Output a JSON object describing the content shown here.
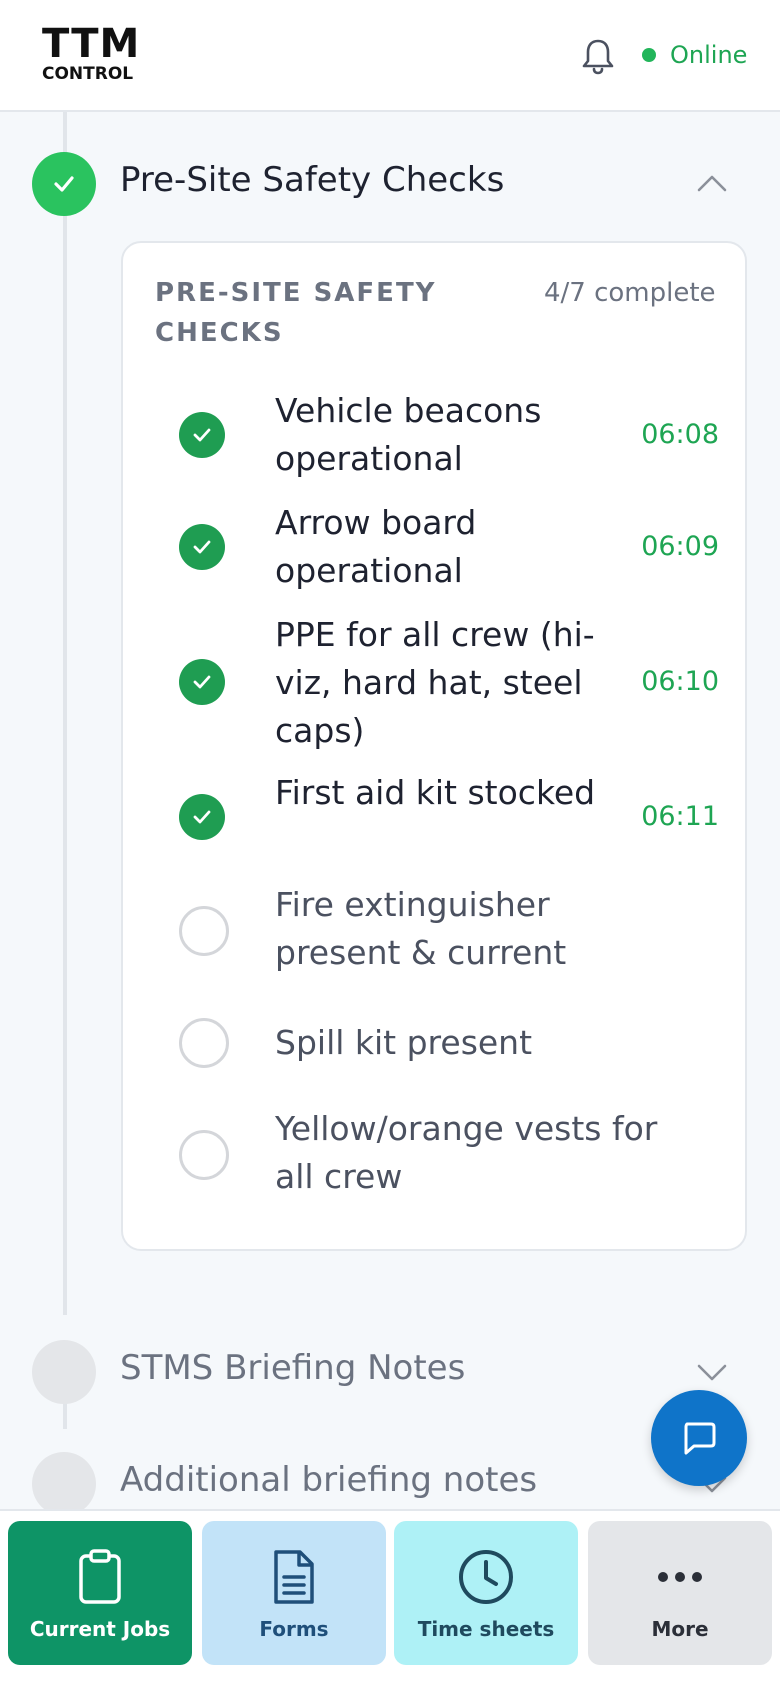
{
  "header": {
    "logo_top": "TTM",
    "logo_bottom": "CONTROL",
    "status_label": "Online",
    "status_color": "#22b55a"
  },
  "timeline": {
    "active_step": {
      "title": "Pre-Site Safety Checks",
      "state": "completed",
      "expanded": true
    },
    "card": {
      "title": "PRE-SITE SAFETY CHECKS",
      "progress": "4/7 complete",
      "items": [
        {
          "label": "Vehicle beacons operational",
          "checked": true,
          "time": "06:08"
        },
        {
          "label": "Arrow board operational",
          "checked": true,
          "time": "06:09"
        },
        {
          "label": "PPE for all crew (hi-viz, hard hat, steel caps)",
          "checked": true,
          "time": "06:10"
        },
        {
          "label": "First aid kit stocked",
          "checked": true,
          "time": "06:11"
        },
        {
          "label": "Fire extinguisher present & current",
          "checked": false,
          "time": ""
        },
        {
          "label": "Spill kit present",
          "checked": false,
          "time": ""
        },
        {
          "label": "Yellow/orange vests for all crew",
          "checked": false,
          "time": ""
        }
      ]
    },
    "collapsed_steps": [
      {
        "title": "STMS Briefing Notes",
        "state": "pending"
      },
      {
        "title": "Additional briefing notes",
        "state": "pending"
      }
    ]
  },
  "bottom_nav": {
    "tabs": [
      {
        "label": "Current Jobs",
        "icon": "clipboard-icon",
        "active": true
      },
      {
        "label": "Forms",
        "icon": "document-icon",
        "active": false
      },
      {
        "label": "Time sheets",
        "icon": "clock-icon",
        "active": false
      },
      {
        "label": "More",
        "icon": "more-dots-icon",
        "active": false
      }
    ]
  },
  "colors": {
    "accent_green": "#2ac35f",
    "check_green": "#1f9d52",
    "time_green": "#1ea553",
    "fab_blue": "#0f74c9",
    "nav_jobs": "#0e9466",
    "nav_forms": "#c2e3f8",
    "nav_time": "#aef1f6",
    "nav_more": "#e4e6e9"
  }
}
